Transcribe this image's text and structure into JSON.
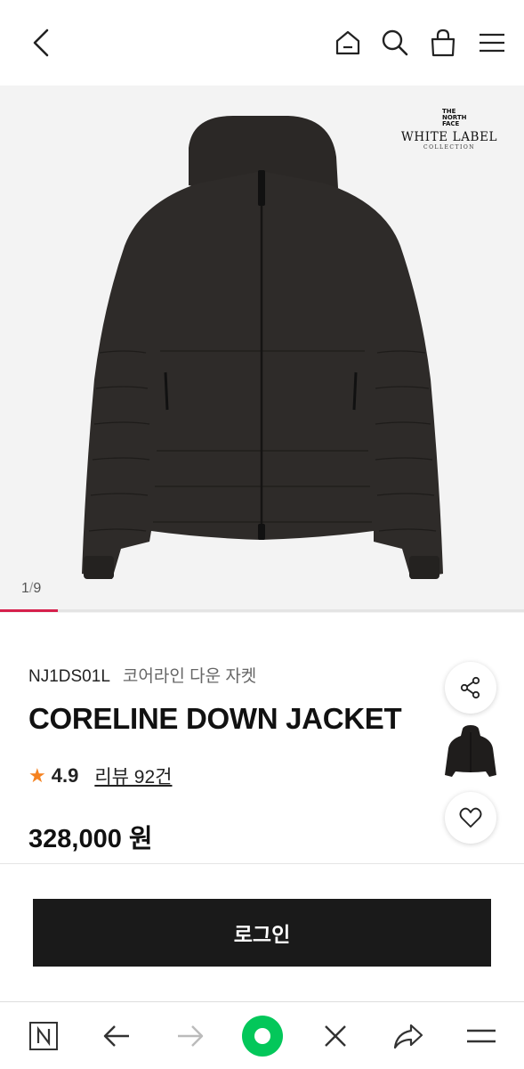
{
  "header": {
    "icons": [
      "chevron-left-icon",
      "home-icon",
      "search-icon",
      "shopping-bag-icon",
      "menu-icon"
    ]
  },
  "gallery": {
    "brand": {
      "tnf_line1": "THE",
      "tnf_line2": "NORTH",
      "tnf_line3": "FACE",
      "label": "WHITE LABEL",
      "collection": "COLLECTION"
    },
    "counter_current": "1",
    "counter_sep": "/",
    "counter_total": "9",
    "progress": 0.111
  },
  "product": {
    "code": "NJ1DS01L",
    "korean_name": "코어라인 다운 자켓",
    "title": "CORELINE DOWN JACKET",
    "rating": "4.9",
    "review_label": "리뷰 92건",
    "price": "328,000 원"
  },
  "actions": {
    "login_label": "로그인"
  },
  "browser_bar": {
    "icons": [
      "naver-n-icon",
      "back-arrow-icon",
      "forward-arrow-icon",
      "green-home-icon",
      "close-icon",
      "share-arrow-icon",
      "menu-icon"
    ]
  },
  "colors": {
    "accent": "#d6204c",
    "star": "#f58220",
    "green": "#03c75a",
    "dark": "#1a1a1a"
  }
}
